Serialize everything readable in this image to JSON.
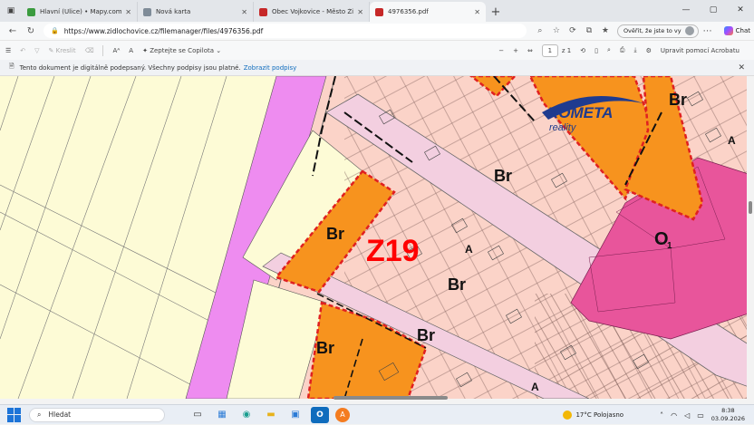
{
  "browser": {
    "tabs": [
      {
        "title": "Hlavní (Ulice) • Mapy.com",
        "favicon_color": "#3b9b3f"
      },
      {
        "title": "Nová karta",
        "favicon_color": "#7f8c98"
      },
      {
        "title": "Obec Vojkovice - Město Židlochovice",
        "favicon_color": "#c62828"
      },
      {
        "title": "4976356.pdf",
        "favicon_color": "#c62828",
        "active": true
      }
    ],
    "url": "https://www.zidlochovice.cz/filemanager/files/4976356.pdf",
    "signin_label": "Ověřit, že jste to vy",
    "chat_label": "Chat"
  },
  "pdf_toolbar": {
    "draw_label": "Kreslit",
    "copilot_label": "Zeptejte se Copilota",
    "page_current": "1",
    "page_total": "z 1",
    "acrobat_label": "Upravit pomocí Acrobatu",
    "minus": "−",
    "plus": "+"
  },
  "infobar": {
    "message": "Tento dokument je digitálně podepsaný. Všechny podpisy jsou platné.",
    "link": "Zobrazit podpisy"
  },
  "map": {
    "zone_label": "Z19",
    "labels": {
      "br_main": "Br",
      "br_left": "Br",
      "br_mid": "Br",
      "br_low1": "Br",
      "br_low2": "Br",
      "br_topright": "Br",
      "a_road": "A",
      "a_right": "A",
      "a_bottom": "A",
      "o_zone": "O",
      "o_sub": "1",
      "logo_top": "KOMETA",
      "logo_bottom": "reality"
    },
    "colors": {
      "residential": "#fbd3c8",
      "proposed_orange": "#f7931e",
      "border_red": "#e02020",
      "road": "#f3cfe0",
      "green_field": "#fdfbd6",
      "pink_civic": "#e8559b",
      "violet_strip": "#ee8cf0",
      "z19_red": "#ff0000"
    }
  },
  "taskbar": {
    "search_placeholder": "Hledat",
    "temperature": "17°C",
    "weather": "Polojasno",
    "time": "8:38",
    "date": "03.09.2026"
  }
}
